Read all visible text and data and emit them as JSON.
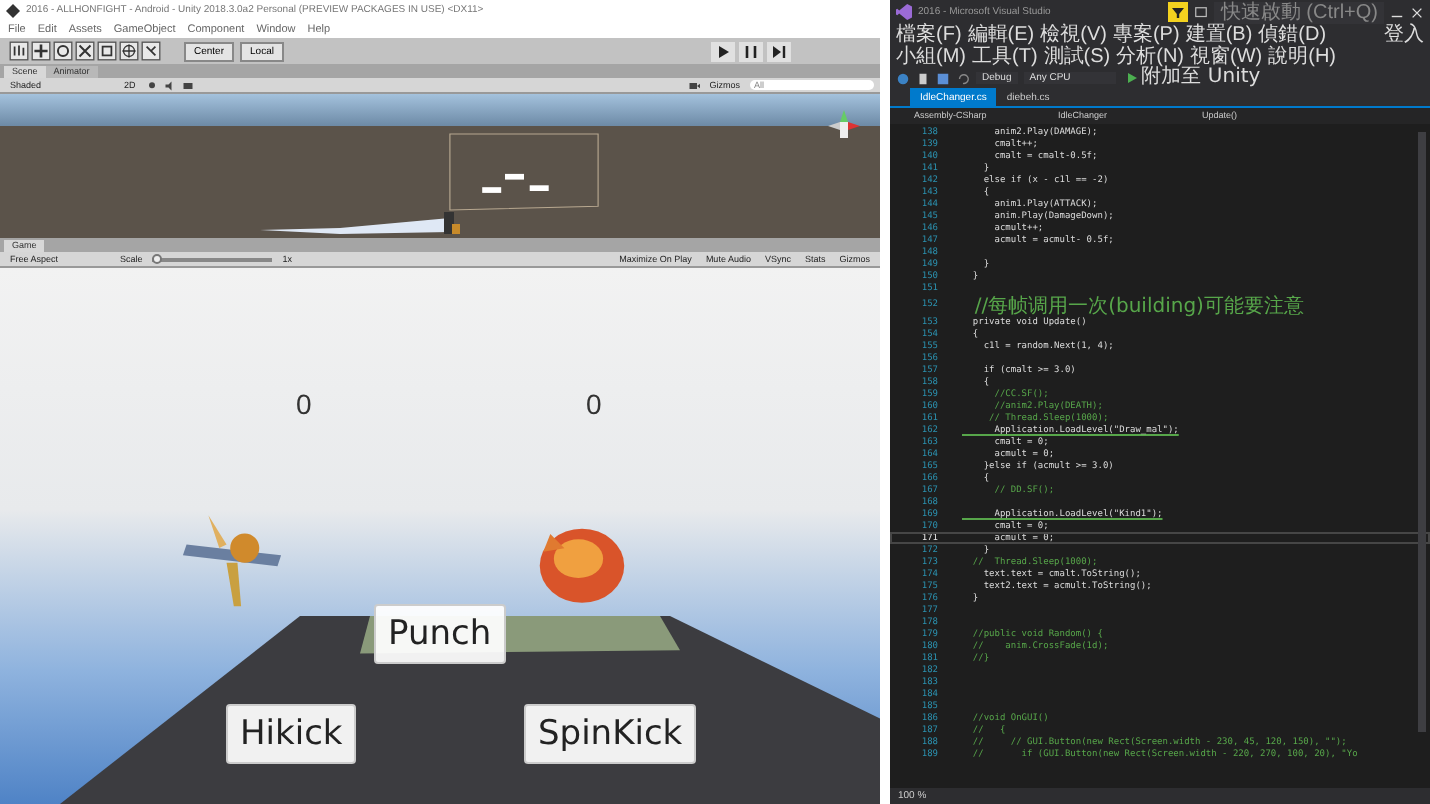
{
  "unity": {
    "title": "2016 - ALLHONFIGHT - Android - Unity 2018.3.0a2 Personal (PREVIEW PACKAGES IN USE) <DX11>",
    "menu": [
      "File",
      "Edit",
      "Assets",
      "GameObject",
      "Component",
      "Window",
      "Help"
    ],
    "toolbar": {
      "pivot": "Center",
      "space": "Local"
    },
    "scene_tabs": [
      {
        "label": "Scene",
        "selected": true
      },
      {
        "label": "Animator",
        "selected": false
      }
    ],
    "scene_toolbar": {
      "shading": "Shaded",
      "mode": "2D",
      "gizmos": "Gizmos",
      "search": "All"
    },
    "game_tab": {
      "label": "Game",
      "selected": true
    },
    "game_toolbar": {
      "aspect": "Free Aspect",
      "scale_label": "Scale",
      "scale": "1x",
      "level": 0,
      "toggles": [
        "Maximize On Play",
        "Mute Audio",
        "VSync",
        "Stats",
        "Gizmos"
      ]
    },
    "game": {
      "scores": [
        "0",
        "0"
      ],
      "buttons": [
        "Punch",
        "Hikick",
        "SpinKick"
      ]
    }
  },
  "vs": {
    "title": "2016 - Microsoft Visual Studio",
    "search": {
      "placeholder": "快速啟動 (Ctrl+Q)"
    },
    "menu": [
      "檔案(F)",
      "編輯(E)",
      "檢視(V)",
      "專案(P)",
      "建置(B)",
      "偵錯(D)",
      "小組(M)",
      "工具(T)",
      "測試(S)",
      "分析(N)",
      "視窗(W)",
      "說明(H)"
    ],
    "account": "登入",
    "toolbar": {
      "config": "Debug",
      "platform": "Any CPU",
      "attach": "附加至 Unity"
    },
    "tabs": [
      {
        "label": "IdleChanger.cs",
        "selected": true
      },
      {
        "label": "diebeh.cs",
        "selected": false
      }
    ],
    "nav": [
      "Assembly-CSharp",
      "IdleChanger",
      "Update()"
    ],
    "lines": [
      {
        "number": "138",
        "text": "      anim2.Play(DAMAGE);",
        "kind": "code",
        "current": false
      },
      {
        "number": "139",
        "text": "      cmalt++;",
        "kind": "code",
        "current": false
      },
      {
        "number": "140",
        "text": "      cmalt = cmalt-0.5f;",
        "kind": "code",
        "current": false
      },
      {
        "number": "141",
        "text": "    }",
        "kind": "code",
        "current": false
      },
      {
        "number": "142",
        "text": "    else if (x - c1l == -2)",
        "kind": "code",
        "current": false
      },
      {
        "number": "143",
        "text": "    {",
        "kind": "code",
        "current": false
      },
      {
        "number": "144",
        "text": "      anim1.Play(ATTACK);",
        "kind": "code",
        "current": false
      },
      {
        "number": "145",
        "text": "      anim.Play(DamageDown);",
        "kind": "code",
        "current": false
      },
      {
        "number": "146",
        "text": "      acmult++;",
        "kind": "code",
        "current": false
      },
      {
        "number": "147",
        "text": "      acmult = acmult- 0.5f;",
        "kind": "code",
        "current": false
      },
      {
        "number": "148",
        "current": false
      },
      {
        "number": "149",
        "text": "    }",
        "kind": "code",
        "current": false
      },
      {
        "number": "150",
        "text": "  }",
        "kind": "code",
        "current": false
      },
      {
        "number": "151",
        "current": false
      },
      {
        "number": "152",
        "text": "  //每帧调用一次(building)可能要注意",
        "kind": "comment",
        "current": false
      },
      {
        "number": "153",
        "text": "  private void Update()",
        "kind": "code",
        "current": false
      },
      {
        "number": "154",
        "text": "  {",
        "kind": "code",
        "current": false
      },
      {
        "number": "155",
        "text": "    c1l = random.Next(1, 4);",
        "kind": "code",
        "current": false
      },
      {
        "number": "156",
        "current": false
      },
      {
        "number": "157",
        "text": "    if (cmalt >= 3.0)",
        "kind": "code",
        "current": false
      },
      {
        "number": "158",
        "text": "    {",
        "kind": "code",
        "current": false
      },
      {
        "number": "159",
        "text": "      //CC.SF();",
        "kind": "comment",
        "current": false
      },
      {
        "number": "160",
        "text": "      //anim2.Play(DEATH);",
        "kind": "comment",
        "current": false
      },
      {
        "number": "161",
        "text": "     // Thread.Sleep(1000);",
        "kind": "comment",
        "current": false
      },
      {
        "number": "162",
        "text": "      Application.LoadLevel(\"Draw_mal\");",
        "kind": "underlined",
        "current": false
      },
      {
        "number": "163",
        "text": "      cmalt = 0;",
        "kind": "code",
        "current": false
      },
      {
        "number": "164",
        "text": "      acmult = 0;",
        "kind": "code",
        "current": false
      },
      {
        "number": "165",
        "text": "    }else if (acmult >= 3.0)",
        "kind": "code",
        "current": false
      },
      {
        "number": "166",
        "text": "    {",
        "kind": "code",
        "current": false
      },
      {
        "number": "167",
        "text": "      // DD.SF();",
        "kind": "comment",
        "current": false
      },
      {
        "number": "168",
        "current": false
      },
      {
        "number": "169",
        "text": "      Application.LoadLevel(\"Kind1\");",
        "kind": "underlined",
        "current": false
      },
      {
        "number": "170",
        "text": "      cmalt = 0;",
        "kind": "code",
        "current": false
      },
      {
        "number": "171",
        "text": "      acmult = 0;",
        "kind": "code",
        "current": true
      },
      {
        "number": "172",
        "text": "    }",
        "kind": "code",
        "current": false
      },
      {
        "number": "173",
        "text": "  //  Thread.Sleep(1000);",
        "kind": "comment",
        "current": false
      },
      {
        "number": "174",
        "text": "    text.text = cmalt.ToString();",
        "kind": "code",
        "current": false
      },
      {
        "number": "175",
        "text": "    text2.text = acmult.ToString();",
        "kind": "code",
        "current": false
      },
      {
        "number": "176",
        "text": "  }",
        "kind": "code",
        "current": false
      },
      {
        "number": "177",
        "current": false
      },
      {
        "number": "178",
        "current": false
      },
      {
        "number": "179",
        "text": "  //public void Random() {",
        "kind": "comment",
        "current": false
      },
      {
        "number": "180",
        "text": "  //    anim.CrossFade(1d);",
        "kind": "comment",
        "current": false
      },
      {
        "number": "181",
        "text": "  //}",
        "kind": "comment",
        "current": false
      },
      {
        "number": "182",
        "current": false
      },
      {
        "number": "183",
        "current": false
      },
      {
        "number": "184",
        "current": false
      },
      {
        "number": "185",
        "current": false
      },
      {
        "number": "186",
        "text": "  //void OnGUI()",
        "kind": "comment",
        "current": false
      },
      {
        "number": "187",
        "text": "  //   {",
        "kind": "comment",
        "current": false
      },
      {
        "number": "188",
        "text": "  //     // GUI.Button(new Rect(Screen.width - 230, 45, 120, 150), \"\");",
        "kind": "comment",
        "current": false
      },
      {
        "number": "189",
        "text": "  //       if (GUI.Button(new Rect(Screen.width - 220, 270, 100, 20), \"Yo",
        "kind": "comment",
        "current": false
      }
    ],
    "status": {
      "zoom": "100 %"
    }
  }
}
